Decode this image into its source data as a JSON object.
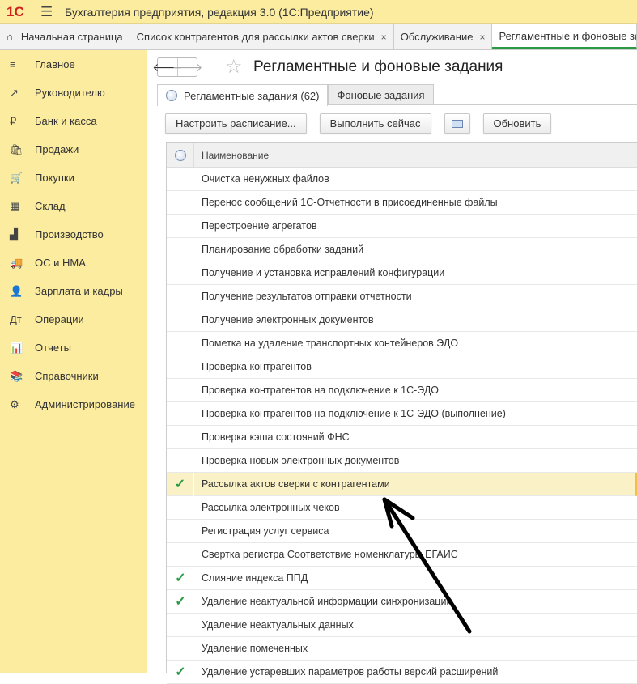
{
  "app": {
    "logo": "1С",
    "menu_icon": "☰",
    "title": "Бухгалтерия предприятия, редакция 3.0  (1С:Предприятие)"
  },
  "tabs": [
    {
      "label": "Начальная страница"
    },
    {
      "label": "Список контрагентов для рассылки актов сверки",
      "close": "×"
    },
    {
      "label": "Обслуживание",
      "close": "×"
    },
    {
      "label": "Регламентные и фоновые задания"
    }
  ],
  "sidebar": [
    {
      "label": "Главное",
      "icon": "≡"
    },
    {
      "label": "Руководителю",
      "icon": "↗"
    },
    {
      "label": "Банк и касса",
      "icon": "₽"
    },
    {
      "label": "Продажи",
      "icon": "🛍"
    },
    {
      "label": "Покупки",
      "icon": "🛒"
    },
    {
      "label": "Склад",
      "icon": "▦"
    },
    {
      "label": "Производство",
      "icon": "▟"
    },
    {
      "label": "ОС и НМА",
      "icon": "🚚"
    },
    {
      "label": "Зарплата и кадры",
      "icon": "👤"
    },
    {
      "label": "Операции",
      "icon": "Дт"
    },
    {
      "label": "Отчеты",
      "icon": "📊"
    },
    {
      "label": "Справочники",
      "icon": "📚"
    },
    {
      "label": "Администрирование",
      "icon": "⚙"
    }
  ],
  "page": {
    "title": "Регламентные и фоновые задания",
    "back": "🡐",
    "forward": "🡒",
    "star": "☆"
  },
  "form_tabs": [
    "Регламентные задания (62)",
    "Фоновые задания"
  ],
  "toolbar": {
    "schedule": "Настроить расписание...",
    "run": "Выполнить сейчас",
    "refresh": "Обновить"
  },
  "grid": {
    "column": "Наименование",
    "check": "✓",
    "rows": [
      {
        "name": "Очистка ненужных файлов",
        "on": false
      },
      {
        "name": "Перенос сообщений 1С-Отчетности в присоединенные файлы",
        "on": false
      },
      {
        "name": "Перестроение агрегатов",
        "on": false
      },
      {
        "name": "Планирование обработки заданий",
        "on": false
      },
      {
        "name": "Получение и установка исправлений конфигурации",
        "on": false
      },
      {
        "name": "Получение результатов отправки отчетности",
        "on": false
      },
      {
        "name": "Получение электронных документов",
        "on": false
      },
      {
        "name": "Пометка на удаление транспортных контейнеров ЭДО",
        "on": false
      },
      {
        "name": "Проверка контрагентов",
        "on": false
      },
      {
        "name": "Проверка контрагентов на подключение к 1С-ЭДО",
        "on": false
      },
      {
        "name": "Проверка контрагентов на подключение к 1С-ЭДО (выполнение)",
        "on": false
      },
      {
        "name": "Проверка кэша состояний ФНС",
        "on": false
      },
      {
        "name": "Проверка новых электронных документов",
        "on": false
      },
      {
        "name": "Рассылка актов сверки с контрагентами",
        "on": true,
        "selected": true
      },
      {
        "name": "Рассылка электронных чеков",
        "on": false
      },
      {
        "name": "Регистрация услуг сервиса",
        "on": false
      },
      {
        "name": "Свертка регистра Соответствие номенклатуры ЕГАИС",
        "on": false
      },
      {
        "name": "Слияние индекса ППД",
        "on": true
      },
      {
        "name": "Удаление неактуальной информации синхронизации",
        "on": true
      },
      {
        "name": "Удаление неактуальных данных",
        "on": false
      },
      {
        "name": "Удаление помеченных",
        "on": false
      },
      {
        "name": "Удаление устаревших параметров работы версий расширений",
        "on": true
      }
    ]
  }
}
